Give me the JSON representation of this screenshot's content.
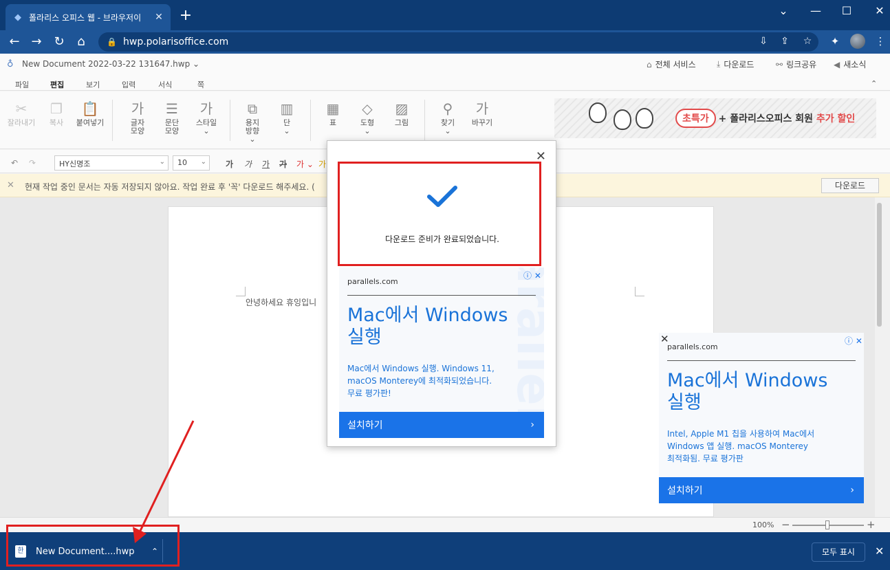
{
  "browser": {
    "tab_title": "폴라리스 오피스 웹 - 브라우저이",
    "url": "hwp.polarisoffice.com"
  },
  "doc": {
    "title": "New Document 2022-03-22 131647.hwp",
    "top_menu": [
      "전체 서비스",
      "다운로드",
      "링크공유",
      "새소식"
    ]
  },
  "menu_tabs": [
    "파일",
    "편집",
    "보기",
    "입력",
    "서식",
    "쪽"
  ],
  "active_tab": "편집",
  "ribbon": {
    "cut": "잘라내기",
    "copy": "복사",
    "paste": "붙여넣기",
    "char_shape": [
      "글자",
      "모양"
    ],
    "para_shape": [
      "문단",
      "모양"
    ],
    "style": "스타일",
    "paper_dir": [
      "용지",
      "방향"
    ],
    "column": "단",
    "table": "표",
    "shape": "도형",
    "image": "그림",
    "find": "찾기",
    "replace": "바꾸기"
  },
  "banner": {
    "pill": "초특가",
    "text_prefix": "+ 폴라리스오피스 회원 ",
    "text_highlight": "추가 할인"
  },
  "format": {
    "font": "HY신명조",
    "size": "10"
  },
  "notice": {
    "text": "현재 작업 중인 문서는 자동 저장되지 않아요. 작업 완료 후 '꼭' 다운로드 해주세요. (",
    "button": "다운로드"
  },
  "page_text": "안녕하세요  휴잉입니",
  "status": {
    "zoom": "100%"
  },
  "modal": {
    "message": "다운로드 준비가 완료되었습니다.",
    "ad": {
      "source": "parallels.com",
      "headline_1": "Mac에서 Windows",
      "headline_2": "실행",
      "body": [
        "Mac에서 Windows 실행. Windows 11,",
        "macOS Monterey에 최적화되었습니다.",
        "무료 평가판!"
      ],
      "cta": "설치하기"
    }
  },
  "side_ad": {
    "source": "parallels.com",
    "headline_1": "Mac에서 Windows",
    "headline_2": "실행",
    "body": [
      "Intel, Apple M1 칩을 사용하여 Mac에서",
      "Windows 앱 실행. macOS Monterey",
      "최적화됨. 무료 평가판"
    ],
    "cta": "설치하기"
  },
  "download_bar": {
    "file": "New Document....hwp",
    "show_all": "모두 표시"
  },
  "colors": {
    "chrome": "#0d3b73",
    "addressbar": "#1e5597",
    "accent": "#1a73e8",
    "annotation": "#e02020"
  }
}
